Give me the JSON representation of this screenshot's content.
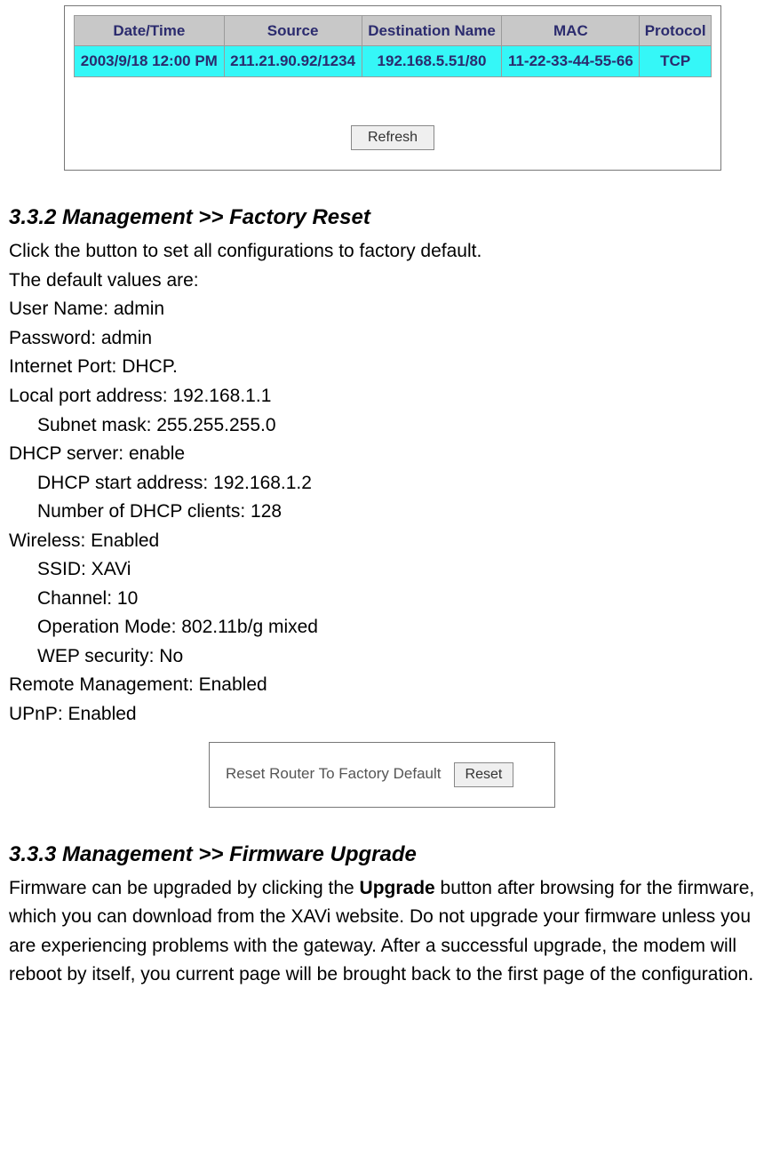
{
  "log": {
    "headers": [
      "Date/Time",
      "Source",
      "Destination Name",
      "MAC",
      "Protocol"
    ],
    "row": {
      "datetime": "2003/9/18 12:00 PM",
      "source": "211.21.90.92/1234",
      "destination": "192.168.5.51/80",
      "mac": "11-22-33-44-55-66",
      "protocol": "TCP"
    },
    "refresh_label": "Refresh"
  },
  "section332": {
    "title": "3.3.2 Management >> Factory Reset",
    "intro": "Click the button to set all configurations to factory default.",
    "defaults_label": "The default values are:",
    "lines": {
      "user_name": "User Name: admin",
      "password": "Password: admin",
      "internet_port": "Internet Port: DHCP.",
      "local_port": "Local port address: 192.168.1.1",
      "subnet_mask": "Subnet mask: 255.255.255.0",
      "dhcp_server": "DHCP server: enable",
      "dhcp_start": "DHCP start address: 192.168.1.2",
      "dhcp_clients": "Number of DHCP clients: 128",
      "wireless": "Wireless: Enabled",
      "ssid": "SSID: XAVi",
      "channel": "Channel: 10",
      "op_mode": "Operation Mode: 802.11b/g mixed",
      "wep": "WEP security: No",
      "remote_mgmt": "Remote Management: Enabled",
      "upnp": "UPnP: Enabled"
    },
    "reset_text": "Reset Router To Factory Default",
    "reset_button": "Reset"
  },
  "section333": {
    "title": "3.3.3 Management >> Firmware Upgrade",
    "p_before_bold": "Firmware can be upgraded by clicking the ",
    "bold_word": "Upgrade",
    "p_after_bold": " button after browsing for the firmware, which you can download from the XAVi website. Do not upgrade your firmware unless you are experiencing problems with the gateway. After a successful upgrade, the modem will reboot by itself, you current page will be brought back to the first page of the configuration."
  }
}
